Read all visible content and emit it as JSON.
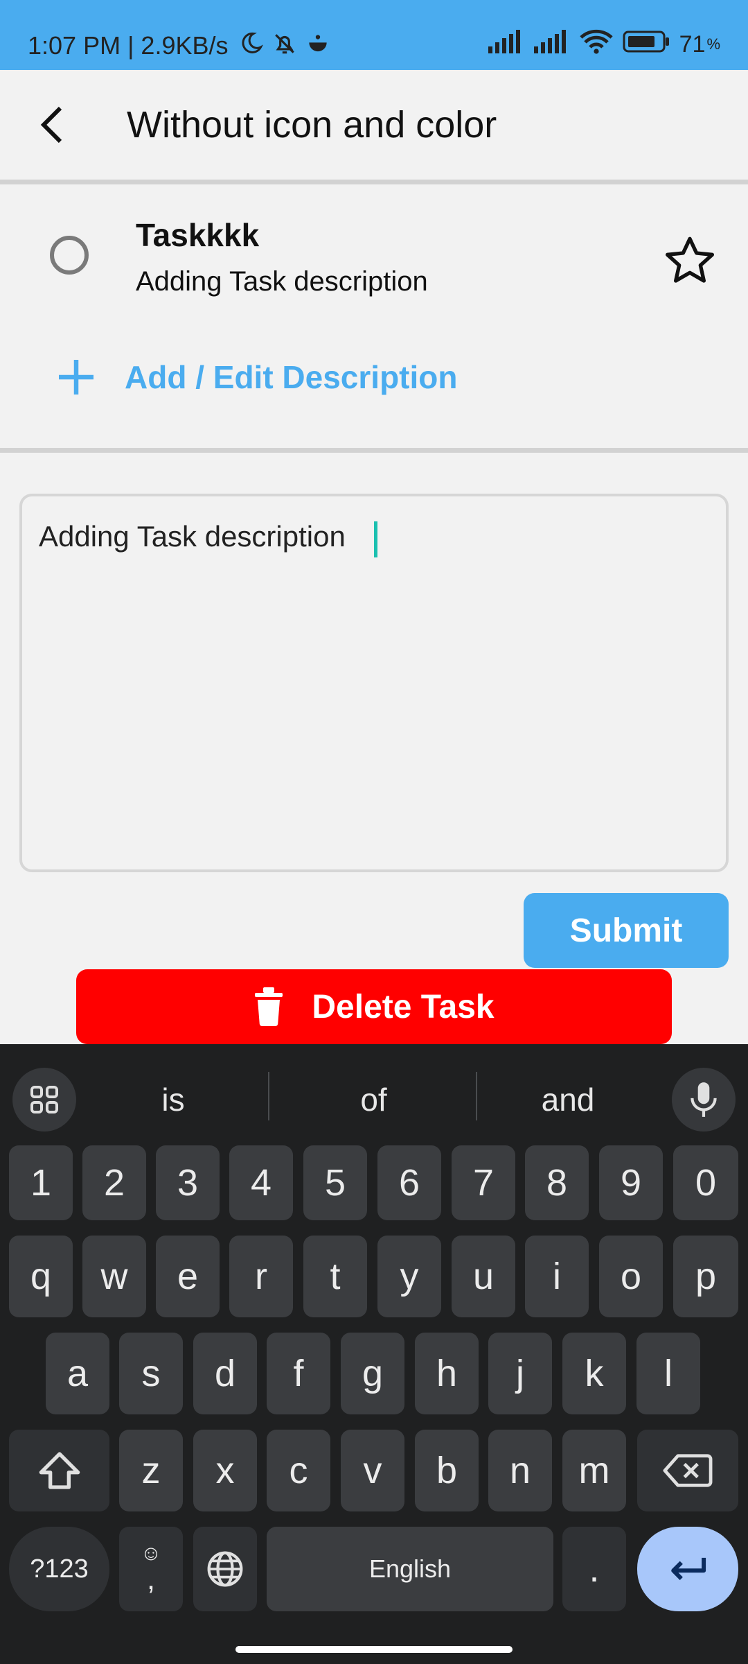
{
  "status_bar": {
    "time_text": "1:07 PM | 2.9KB/s",
    "battery_text": "71",
    "battery_unit": "%"
  },
  "app_bar": {
    "title": "Without icon and color"
  },
  "task": {
    "title": "Taskkkk",
    "description": "Adding Task description",
    "starred": false
  },
  "add_edit_label": "Add / Edit Description",
  "description_input": {
    "value": "Adding Task description"
  },
  "submit_label": "Submit",
  "delete_label": "Delete Task",
  "keyboard": {
    "suggestions": [
      "is",
      "of",
      "and"
    ],
    "number_row": [
      "1",
      "2",
      "3",
      "4",
      "5",
      "6",
      "7",
      "8",
      "9",
      "0"
    ],
    "row1": [
      "q",
      "w",
      "e",
      "r",
      "t",
      "y",
      "u",
      "i",
      "o",
      "p"
    ],
    "row2": [
      "a",
      "s",
      "d",
      "f",
      "g",
      "h",
      "j",
      "k",
      "l"
    ],
    "row3": [
      "z",
      "x",
      "c",
      "v",
      "b",
      "n",
      "m"
    ],
    "symbols_label": "?123",
    "comma_label": ",",
    "emoji_label": "☺",
    "space_label": "English",
    "period_label": "."
  },
  "colors": {
    "accent": "#4aacef",
    "delete": "#ff0000",
    "keyboard_bg": "#1f2021",
    "enter_key": "#a8c7fa"
  }
}
